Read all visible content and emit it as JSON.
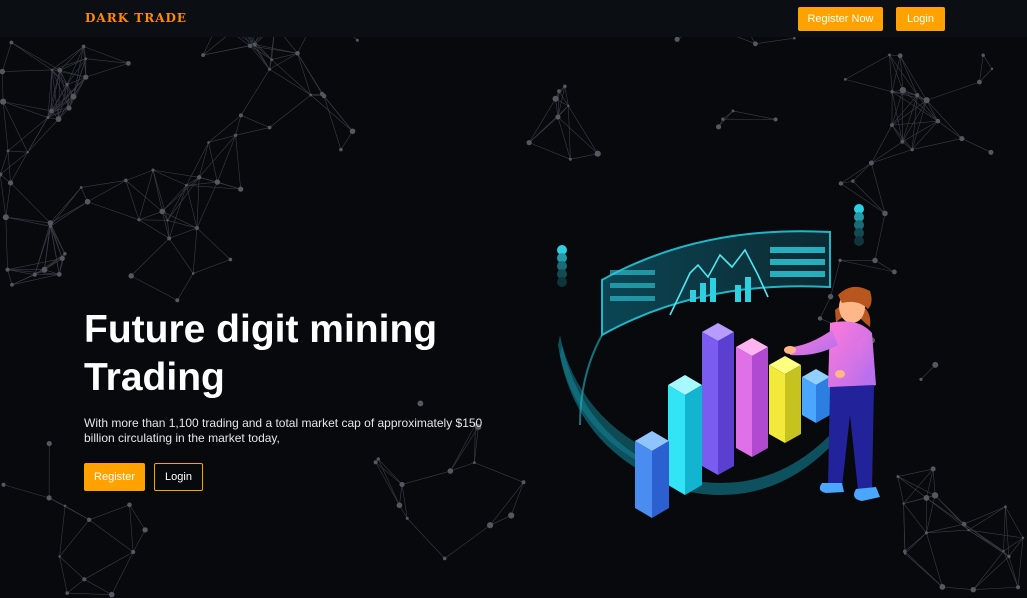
{
  "header": {
    "logo_text": "DARK TRADE",
    "register_label": "Register Now",
    "login_label": "Login"
  },
  "hero": {
    "title_line1": "Future digit mining",
    "title_line2": "Trading",
    "description": "With more than 1,100 trading and a total market cap of approximately $150 billion circulating in the market today,",
    "register_label": "Register",
    "login_label": "Login"
  },
  "colors": {
    "background": "#07090d",
    "topbar": "#0b0e13",
    "accent": "#ffa200",
    "logo": "#ff8a00",
    "network_lines": "#3a3d44"
  },
  "illustration": {
    "subject": "person-with-3d-bar-chart-and-curved-holographic-screen"
  }
}
